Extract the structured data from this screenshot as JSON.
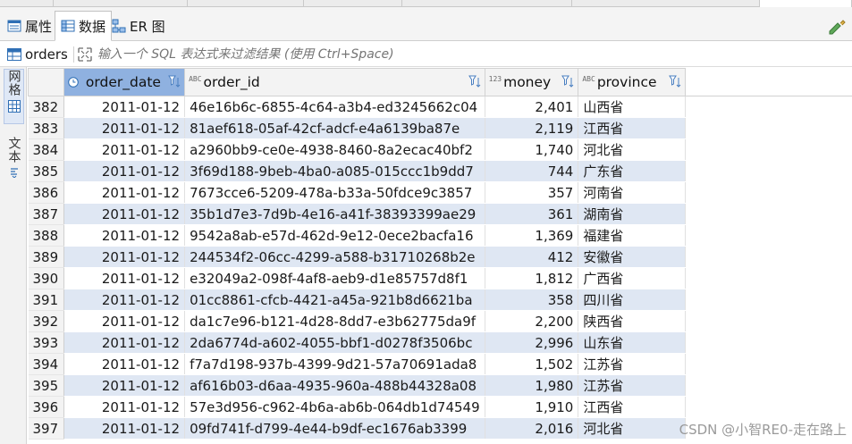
{
  "view_tabs": [
    {
      "label": "属性",
      "icon": "properties-icon",
      "active": false
    },
    {
      "label": "数据",
      "icon": "data-grid-icon",
      "active": true
    },
    {
      "label": "ER 图",
      "icon": "er-diagram-icon",
      "active": false
    }
  ],
  "filter": {
    "table_name": "orders",
    "placeholder": "输入一个 SQL 表达式来过滤结果 (使用 Ctrl+Space)"
  },
  "left_panel": {
    "grid_label": "网格",
    "text_label": "文本"
  },
  "columns": [
    {
      "name": "order_date",
      "type_badge": "",
      "sorted": true
    },
    {
      "name": "order_id",
      "type_badge": "ABC",
      "sorted": false
    },
    {
      "name": "money",
      "type_badge": "123",
      "sorted": false
    },
    {
      "name": "province",
      "type_badge": "ABC",
      "sorted": false
    }
  ],
  "rows": [
    {
      "n": "382",
      "date": "2011-01-12",
      "id": "46e16b6c-6855-4c64-a3b4-ed3245662c04",
      "money": "2,401",
      "province": "山西省"
    },
    {
      "n": "383",
      "date": "2011-01-12",
      "id": "81aef618-05af-42cf-adcf-e4a6139ba87e",
      "money": "2,119",
      "province": "江西省"
    },
    {
      "n": "384",
      "date": "2011-01-12",
      "id": "a2960bb9-ce0e-4938-8460-8a2ecac40bf2",
      "money": "1,740",
      "province": "河北省"
    },
    {
      "n": "385",
      "date": "2011-01-12",
      "id": "3f69d188-9beb-4ba0-a085-015ccc1b9dd7",
      "money": "744",
      "province": "广东省"
    },
    {
      "n": "386",
      "date": "2011-01-12",
      "id": "7673cce6-5209-478a-b33a-50fdce9c3857",
      "money": "357",
      "province": "河南省"
    },
    {
      "n": "387",
      "date": "2011-01-12",
      "id": "35b1d7e3-7d9b-4e16-a41f-38393399ae29",
      "money": "361",
      "province": "湖南省"
    },
    {
      "n": "388",
      "date": "2011-01-12",
      "id": "9542a8ab-e57d-462d-9e12-0ece2bacfa16",
      "money": "1,369",
      "province": "福建省"
    },
    {
      "n": "389",
      "date": "2011-01-12",
      "id": "244534f2-06cc-4299-a588-b31710268b2e",
      "money": "412",
      "province": "安徽省"
    },
    {
      "n": "390",
      "date": "2011-01-12",
      "id": "e32049a2-098f-4af8-aeb9-d1e85757d8f1",
      "money": "1,812",
      "province": "广西省"
    },
    {
      "n": "391",
      "date": "2011-01-12",
      "id": "01cc8861-cfcb-4421-a45a-921b8d6621ba",
      "money": "358",
      "province": "四川省"
    },
    {
      "n": "392",
      "date": "2011-01-12",
      "id": "da1c7e96-b121-4d28-8dd7-e3b62775da9f",
      "money": "2,200",
      "province": "陕西省"
    },
    {
      "n": "393",
      "date": "2011-01-12",
      "id": "2da6774d-a602-4055-bbf1-d0278f3506bc",
      "money": "2,996",
      "province": "山东省"
    },
    {
      "n": "394",
      "date": "2011-01-12",
      "id": "f7a7d198-937b-4399-9d21-57a70691ada8",
      "money": "1,502",
      "province": "江苏省"
    },
    {
      "n": "395",
      "date": "2011-01-12",
      "id": "af616b03-d6aa-4935-960a-488b44328a08",
      "money": "1,980",
      "province": "江苏省"
    },
    {
      "n": "396",
      "date": "2011-01-12",
      "id": "57e3d956-c962-4b6a-ab6b-064db1d74549",
      "money": "1,910",
      "province": "江西省"
    },
    {
      "n": "397",
      "date": "2011-01-12",
      "id": "09fd741f-d799-4e44-b9df-ec1676ab3399",
      "money": "2,016",
      "province": "河北省"
    }
  ],
  "watermark": "CSDN @小智RE0-走在路上",
  "colors": {
    "accent": "#8fb1e0",
    "alt_row": "#dfe7f3",
    "link_blue": "#1f6fd0"
  }
}
